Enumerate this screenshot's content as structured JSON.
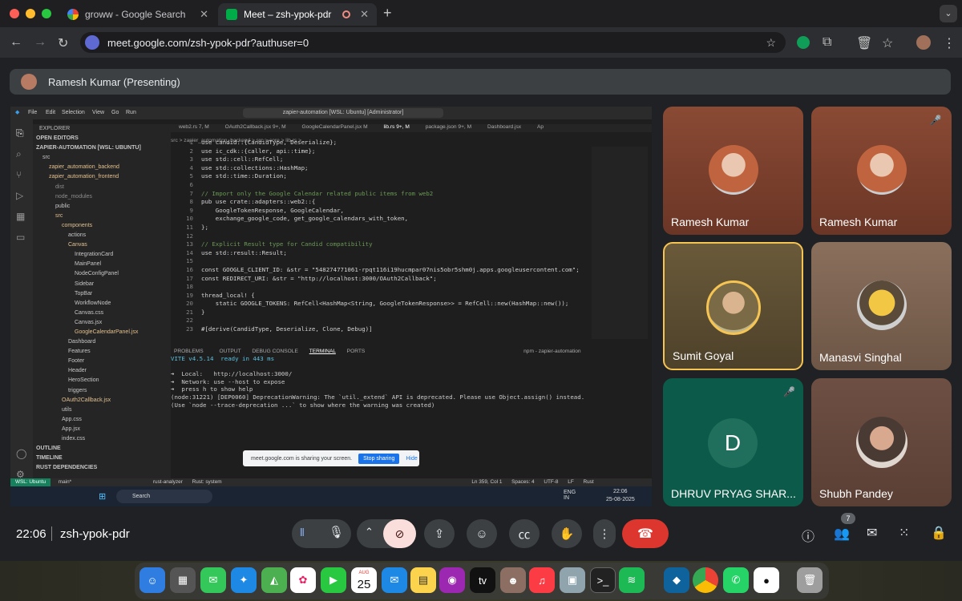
{
  "browser": {
    "tabs": [
      {
        "label": "groww - Google Search"
      },
      {
        "label": "Meet – zsh-ypok-pdr"
      }
    ],
    "new_tab": "+",
    "url": "meet.google.com/zsh-ypok-pdr?authuser=0"
  },
  "meet": {
    "presenting_label": "Ramesh Kumar (Presenting)",
    "time": "22:06",
    "meeting_code": "zsh-ypok-pdr",
    "people_count": "7",
    "participants": [
      {
        "name": "Ramesh Kumar"
      },
      {
        "name": "Ramesh Kumar"
      },
      {
        "name": "Sumit Goyal"
      },
      {
        "name": "Manasvi Singhal"
      },
      {
        "name": "DHRUV PRYAG SHAR...",
        "initial": "D"
      },
      {
        "name": "Shubh Pandey"
      }
    ]
  },
  "vscode": {
    "menu": [
      "File",
      "Edit",
      "Selection",
      "View",
      "Go",
      "Run"
    ],
    "search": "zapier-automation [WSL: Ubuntu] [Administrator]",
    "tabs": [
      "web2.rs 7, M",
      "OAuth2Callback.jsx 9+, M",
      "GoogleCalendarPanel.jsx M",
      "lib.rs 9+, M",
      "package.json 9+, M",
      "Dashboard.jsx",
      "Ap"
    ],
    "breadcrumb": "src > zapier_automation_backend > src > core > lib.rs > ...",
    "explorer_title": "EXPLORER",
    "tree": [
      "OPEN EDITORS",
      "ZAPIER-AUTOMATION [WSL: UBUNTU]",
      "src",
      "zapier_automation_backend",
      "zapier_automation_frontend",
      "dist",
      "node_modules",
      "public",
      "src",
      "components",
      "actions",
      "Canvas",
      "IntegrationCard",
      "MainPanel",
      "NodeConfigPanel",
      "Sidebar",
      "TopBar",
      "WorkflowNode",
      "Canvas.css",
      "Canvas.jsx",
      "GoogleCalendarPanel.jsx",
      "Dashboard",
      "Features",
      "Footer",
      "Header",
      "HeroSection",
      "triggers",
      "OAuth2Callback.jsx",
      "utils",
      "App.css",
      "App.jsx",
      "index.css"
    ],
    "tree_footer": [
      "OUTLINE",
      "TIMELINE",
      "RUST DEPENDENCIES"
    ],
    "code": [
      "use candid::{CandidType, Deserialize};",
      "use ic_cdk::{caller, api::time};",
      "use std::cell::RefCell;",
      "use std::collections::HashMap;",
      "use std::time::Duration;",
      "",
      "// Import only the Google Calendar related public items from web2",
      "pub use crate::adapters::web2::{",
      "    GoogleTokenResponse, GoogleCalendar,",
      "    exchange_google_code, get_google_calendars_with_token,",
      "};",
      "",
      "// Explicit Result type for Candid compatibility",
      "use std::result::Result;",
      "",
      "const GOOGLE_CLIENT_ID: &str = \"548274771061-rpqt116i19hucmpar07nis5obr5shm0j.apps.googleusercontent.com\";",
      "const REDIRECT_URI: &str = \"http://localhost:3000/OAuth2Callback\";",
      "",
      "thread_local! {",
      "    static GOOGLE_TOKENS: RefCell<HashMap<String, GoogleTokenResponse>> = RefCell::new(HashMap::new());",
      "}",
      "",
      "#[derive(CandidType, Deserialize, Clone, Debug)]"
    ],
    "panel_tabs": [
      "PROBLEMS",
      "OUTPUT",
      "DEBUG CONSOLE",
      "TERMINAL",
      "PORTS"
    ],
    "terminal_name": "npm - zapier-automation",
    "terminal": [
      "VITE v4.5.14  ready in 443 ms",
      "",
      "➜  Local:   http://localhost:3000/",
      "➜  Network: use --host to expose",
      "➜  press h to show help",
      "(node:31221) [DEP0060] DeprecationWarning: The `util._extend` API is deprecated. Please use Object.assign() instead.",
      "(Use `node --trace-deprecation ...` to show where the warning was created)"
    ],
    "sharing_msg": "meet.google.com is sharing your screen.",
    "stop_sharing": "Stop sharing",
    "hide": "Hide",
    "status_left": "WSL: Ubuntu",
    "status_branch": "main*",
    "status_items": [
      "rust-analyzer",
      "Rust: system"
    ],
    "status_right": [
      "Ln 359, Col 1",
      "Spaces: 4",
      "UTF-8",
      "LF",
      "Rust"
    ],
    "taskbar_search": "Search",
    "taskbar_lang": "ENG IN",
    "taskbar_time": "22:06",
    "taskbar_date": "25-08-2025"
  },
  "dock": {
    "calendar_month": "AUG",
    "calendar_day": "25",
    "tv": "tv"
  }
}
